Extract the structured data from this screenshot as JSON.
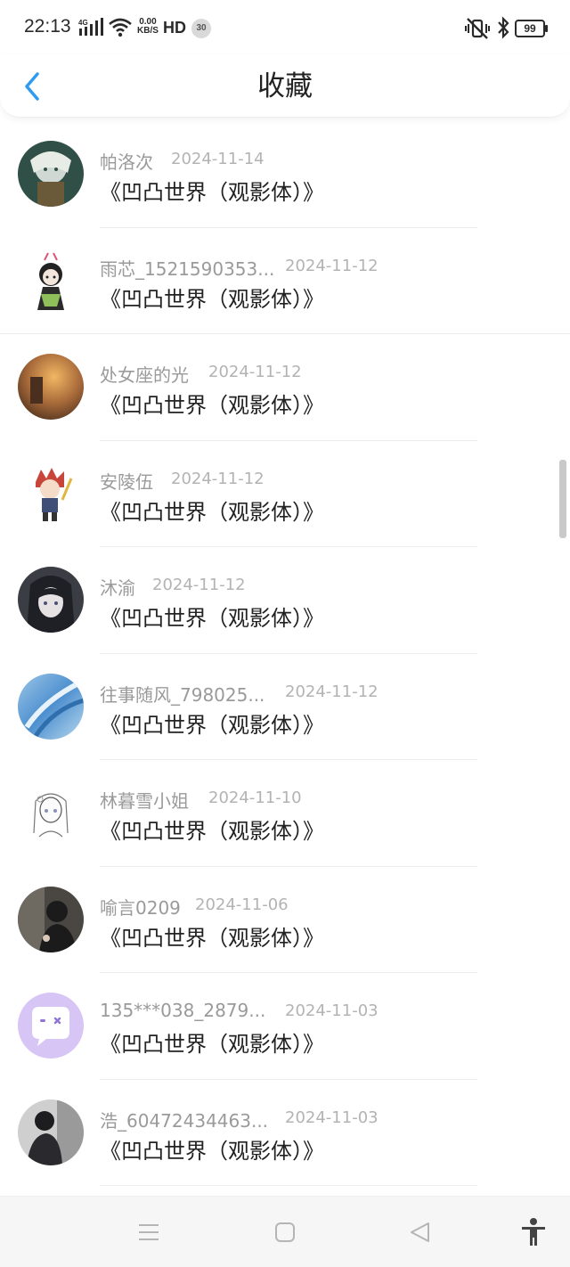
{
  "status_bar": {
    "time": "22:13",
    "network": "4G",
    "speed_value": "0.00",
    "speed_unit": "KB/S",
    "hd": "HD",
    "badge": "30",
    "battery": "99"
  },
  "header": {
    "title": "收藏",
    "back_icon": "chevron-left-icon",
    "accent_color": "#2f9bf0"
  },
  "favorites": [
    {
      "username": "帕洛次",
      "date": "2024-11-14",
      "title": "《凹凸世界（观影体）》"
    },
    {
      "username": "雨芯_1521590353...",
      "date": "2024-11-12",
      "title": "《凹凸世界（观影体）》"
    },
    {
      "username": "处女座的光",
      "date": "2024-11-12",
      "title": "《凹凸世界（观影体）》"
    },
    {
      "username": "安陵伍",
      "date": "2024-11-12",
      "title": "《凹凸世界（观影体）》"
    },
    {
      "username": "沐渝",
      "date": "2024-11-12",
      "title": "《凹凸世界（观影体）》"
    },
    {
      "username": "往事随风_798025...",
      "date": "2024-11-12",
      "title": "《凹凸世界（观影体）》"
    },
    {
      "username": "林暮雪小姐",
      "date": "2024-11-10",
      "title": "《凹凸世界（观影体）》"
    },
    {
      "username": "喻言0209",
      "date": "2024-11-06",
      "title": "《凹凸世界（观影体）》"
    },
    {
      "username": "135***038_2879...",
      "date": "2024-11-03",
      "title": "《凹凸世界（观影体）》"
    },
    {
      "username": "浩_60472434463...",
      "date": "2024-11-03",
      "title": "《凹凸世界（观影体）》"
    }
  ],
  "nav_bar": {
    "icons": [
      "menu-icon",
      "home-square-icon",
      "back-triangle-icon",
      "accessibility-icon"
    ]
  }
}
